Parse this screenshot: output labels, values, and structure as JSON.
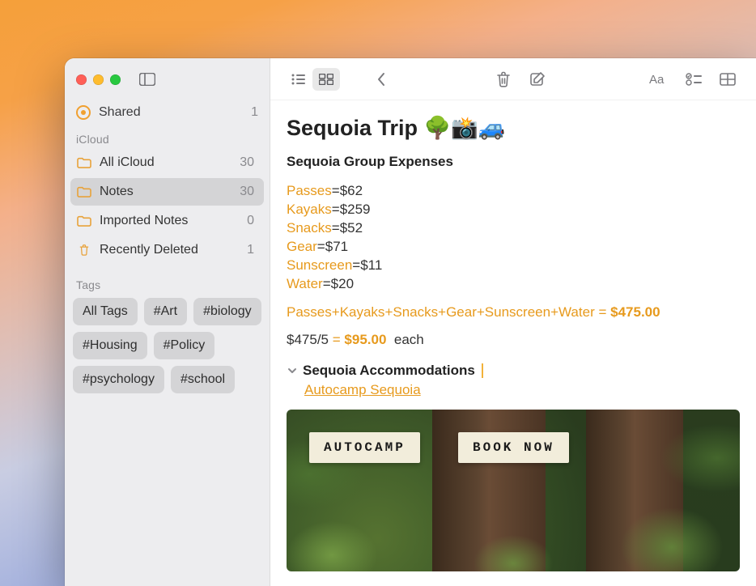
{
  "sidebar": {
    "shared": {
      "label": "Shared",
      "count": "1"
    },
    "section_icloud": "iCloud",
    "folders": [
      {
        "label": "All iCloud",
        "count": "30"
      },
      {
        "label": "Notes",
        "count": "30"
      },
      {
        "label": "Imported Notes",
        "count": "0"
      },
      {
        "label": "Recently Deleted",
        "count": "1"
      }
    ],
    "section_tags": "Tags",
    "tags": [
      "All Tags",
      "#Art",
      "#biology",
      "#Housing",
      "#Policy",
      "#psychology",
      "#school"
    ]
  },
  "note": {
    "title": "Sequoia Trip 🌳📸🚙",
    "subtitle": "Sequoia Group Expenses",
    "expenses": [
      {
        "name": "Passes",
        "value": "$62"
      },
      {
        "name": "Kayaks",
        "value": "$259"
      },
      {
        "name": "Snacks",
        "value": "$52"
      },
      {
        "name": "Gear",
        "value": "$71"
      },
      {
        "name": "Sunscreen",
        "value": "$11"
      },
      {
        "name": "Water",
        "value": "$20"
      }
    ],
    "formula_items": [
      "Passes",
      "Kayaks",
      "Snacks",
      "Gear",
      "Sunscreen",
      "Water"
    ],
    "formula_total": "$475.00",
    "per_prefix": "$475/5",
    "per_value": "$95.00",
    "per_suffix": "each",
    "accom_heading": "Sequoia Accommodations",
    "link": "Autocamp Sequoia",
    "photo": {
      "label_a": "AUTOCAMP",
      "label_b": "BOOK NOW"
    }
  }
}
